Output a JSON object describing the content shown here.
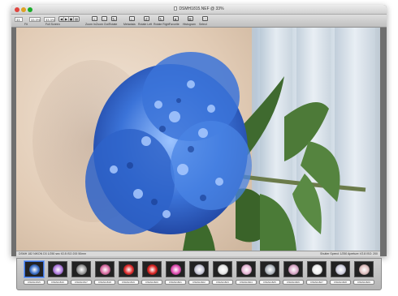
{
  "window": {
    "title": "DSMH1815.NEF @ 33%"
  },
  "toolbar": {
    "zoom_value": "33",
    "size_value": "33.3%",
    "size_value2": "33.3%",
    "labels": [
      "Fit",
      "Full Screen",
      "Zoom In",
      "Zoom Out",
      "Rotate",
      "File",
      "Metadata",
      "Rotate Left",
      "Rotate Right",
      "Favorite",
      "Histogram",
      "Select",
      "Save"
    ],
    "segments": [
      "◀",
      "▶",
      "▣",
      "▤"
    ]
  },
  "status": {
    "left": "DSMH 182 NIKON D3 1/250 sec f/2.8 ISO 200 50mm",
    "right": "Shutter Speed: 1/250   Aperture: f/2.8   ISO: 200"
  },
  "filmstrip": {
    "thumbs": [
      {
        "label": "DSMH1815",
        "color": "#3a6fc8"
      },
      {
        "label": "DSMH1816",
        "color": "#b07be0"
      },
      {
        "label": "DSMH1817",
        "color": "#9a9a9a"
      },
      {
        "label": "DSMH1818",
        "color": "#d86aa0"
      },
      {
        "label": "DSMH1819",
        "color": "#e02a2a"
      },
      {
        "label": "DSMH1820",
        "color": "#d8201e"
      },
      {
        "label": "DSMH1821",
        "color": "#e04ab0"
      },
      {
        "label": "DSMH1822",
        "color": "#c8c8d8"
      },
      {
        "label": "DSMH1823",
        "color": "#e7e7e7"
      },
      {
        "label": "DSMH1824",
        "color": "#e8b8d8"
      },
      {
        "label": "DSMH1825",
        "color": "#b1b8c0"
      },
      {
        "label": "DSMH1826",
        "color": "#d9a8c8"
      },
      {
        "label": "DSMH1827",
        "color": "#f0f0f0"
      },
      {
        "label": "DSMH1828",
        "color": "#d0d0e0"
      },
      {
        "label": "DSMH1829",
        "color": "#e0c0c0"
      }
    ]
  },
  "colors": {
    "flower": "#3b73d8",
    "leaf": "#3f6a2f"
  }
}
